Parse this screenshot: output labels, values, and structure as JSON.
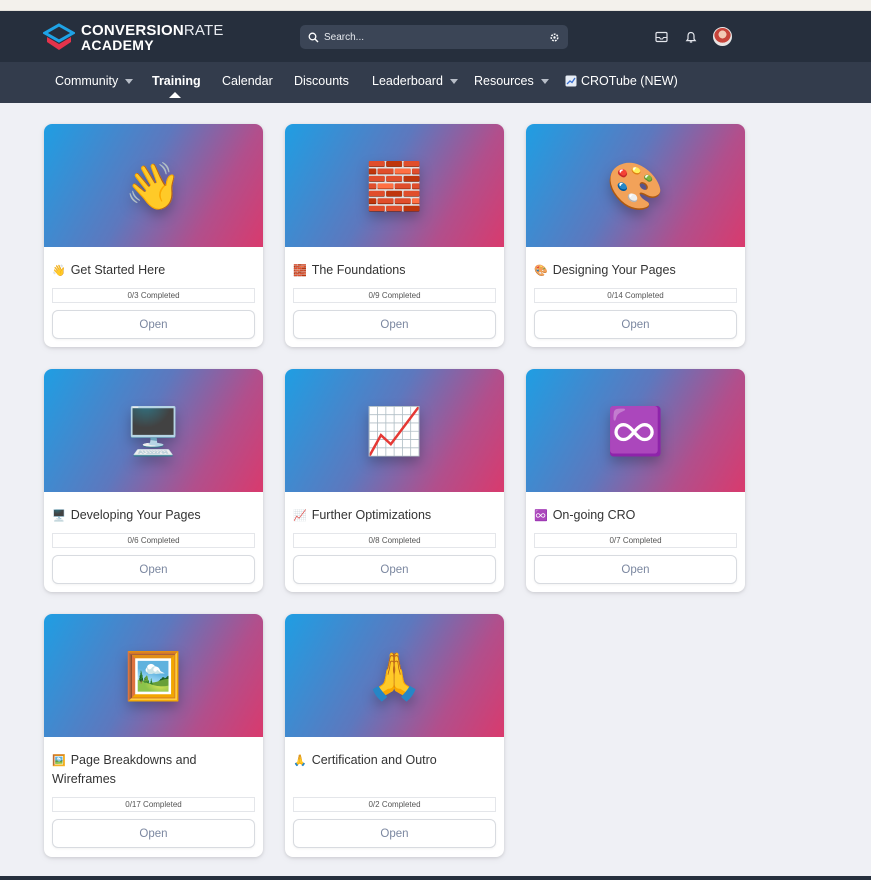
{
  "logo": {
    "line1_bold": "CONVERSION",
    "line1_light": "RATE",
    "line2": "ACADEMY"
  },
  "search": {
    "placeholder": "Search..."
  },
  "nav": [
    {
      "label": "Community",
      "dropdown": true
    },
    {
      "label": "Training",
      "dropdown": false,
      "active": true
    },
    {
      "label": "Calendar",
      "dropdown": false
    },
    {
      "label": "Discounts",
      "dropdown": false
    },
    {
      "label": "Leaderboard",
      "dropdown": true
    },
    {
      "label": "Resources",
      "dropdown": true
    },
    {
      "label": "CROTube (NEW)",
      "dropdown": false,
      "icon": "chart-icon"
    }
  ],
  "courses": [
    {
      "title": "Get Started Here",
      "icon": "👋",
      "hero": "👋",
      "progress": "0/3 Completed",
      "button": "Open"
    },
    {
      "title": "The Foundations",
      "icon": "🧱",
      "hero": "🧱",
      "progress": "0/9 Completed",
      "button": "Open"
    },
    {
      "title": "Designing Your Pages",
      "icon": "🎨",
      "hero": "🎨",
      "progress": "0/14 Completed",
      "button": "Open"
    },
    {
      "title": "Developing Your Pages",
      "icon": "🖥️",
      "hero": "🖥️",
      "progress": "0/6 Completed",
      "button": "Open"
    },
    {
      "title": "Further Optimizations",
      "icon": "📈",
      "hero": "📈",
      "progress": "0/8 Completed",
      "button": "Open"
    },
    {
      "title": "On-going CRO",
      "icon": "♾️",
      "hero": "♾️",
      "progress": "0/7 Completed",
      "button": "Open"
    },
    {
      "title": "Page Breakdowns and Wireframes",
      "icon": "🖼️",
      "hero": "🖼️",
      "progress": "0/17 Completed",
      "button": "Open"
    },
    {
      "title": "Certification and Outro",
      "icon": "🙏",
      "hero": "🙏",
      "progress": "0/2 Completed",
      "button": "Open"
    }
  ],
  "colors": {
    "header_bg": "#262f3d",
    "nav_bg": "#333c4c",
    "page_bg": "#eff0f5",
    "gradient": [
      "#1f9ee3",
      "#d93a6d"
    ]
  }
}
